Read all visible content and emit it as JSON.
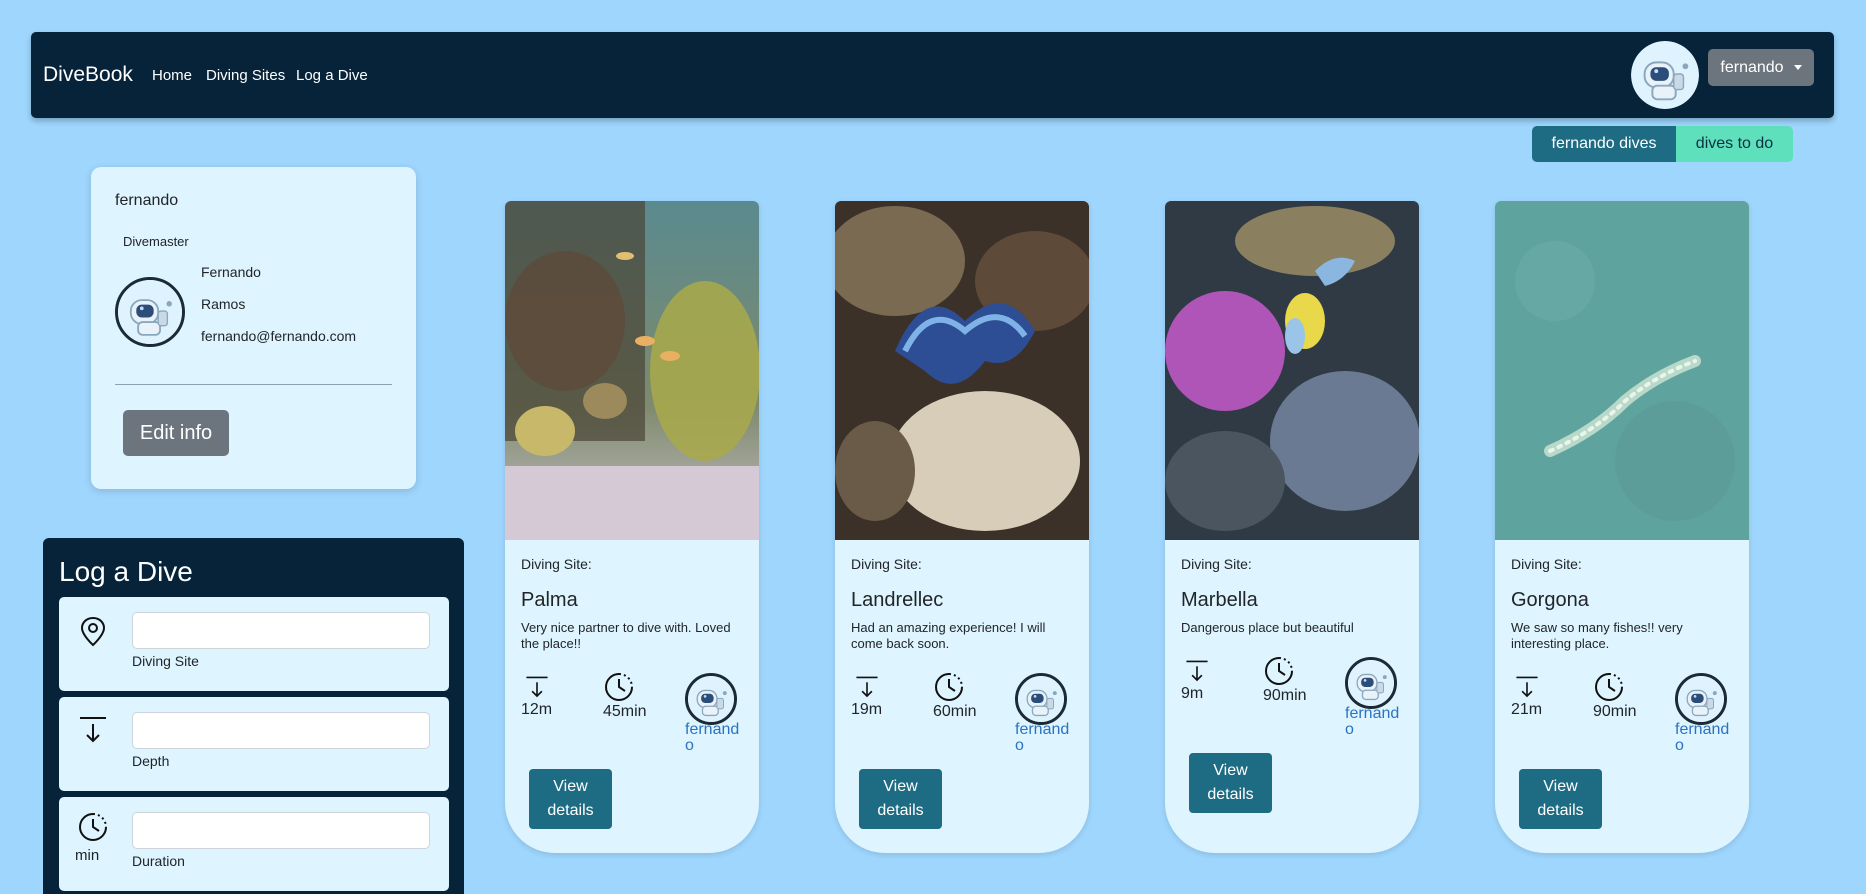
{
  "navbar": {
    "brand": "DiveBook",
    "links": [
      "Home",
      "Diving Sites",
      "Log a Dive"
    ],
    "user_menu": "fernando"
  },
  "toggle": {
    "own": "fernando dives",
    "todo": "dives to do"
  },
  "profile": {
    "username": "fernando",
    "role": "Divemaster",
    "first_name": "Fernando",
    "last_name": "Ramos",
    "email": "fernando@fernando.com",
    "edit_label": "Edit info"
  },
  "log_dive": {
    "title": "Log a Dive",
    "site_label": "Diving Site",
    "depth_label": "Depth",
    "duration_label": "Duration",
    "duration_unit": "min",
    "site_value": "",
    "depth_value": "",
    "duration_value": ""
  },
  "cards": [
    {
      "label": "Diving Site:",
      "site": "Palma",
      "description": "Very nice partner to dive with. Loved the place!!",
      "depth": "12m",
      "duration": "45min",
      "user": "fernando",
      "button": "View details"
    },
    {
      "label": "Diving Site:",
      "site": "Landrellec",
      "description": "Had an amazing experience! I will come back soon.",
      "depth": "19m",
      "duration": "60min",
      "user": "fernando",
      "button": "View details"
    },
    {
      "label": "Diving Site:",
      "site": "Marbella",
      "description": "Dangerous place but beautiful",
      "depth": "9m",
      "duration": "90min",
      "user": "fernando",
      "button": "View details"
    },
    {
      "label": "Diving Site:",
      "site": "Gorgona",
      "description": "We saw so many fishes!! very interesting place.",
      "depth": "21m",
      "duration": "90min",
      "user": "fernando",
      "button": "View details"
    }
  ]
}
